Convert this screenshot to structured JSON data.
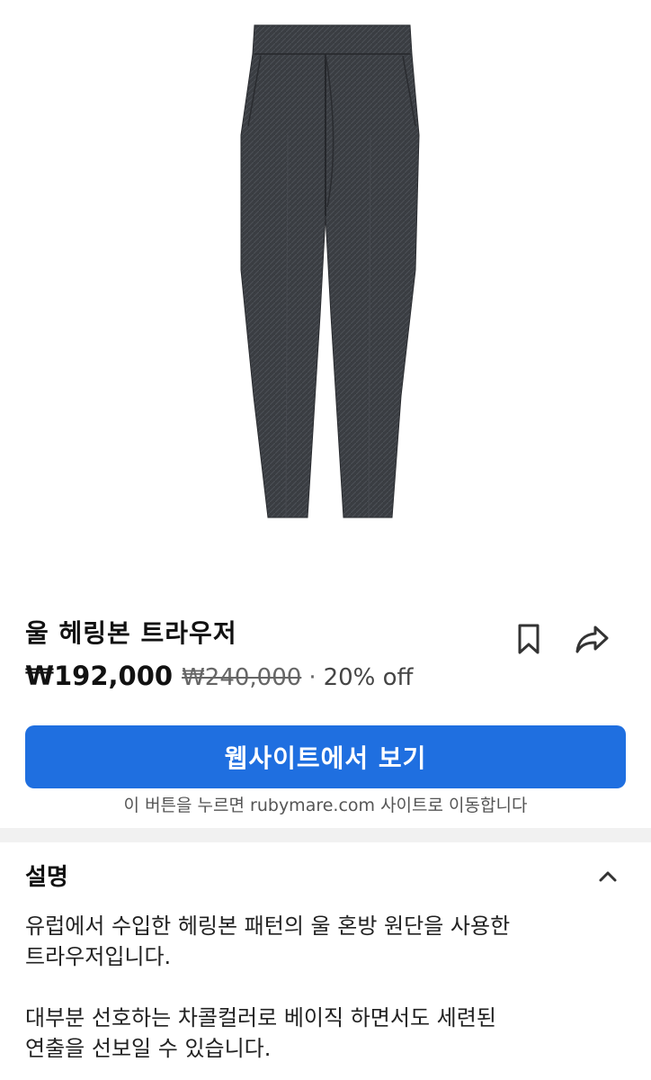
{
  "product": {
    "image_icon": "product-photo-trousers",
    "title": "울 헤링본 트라우저",
    "price_current": "₩192,000",
    "price_original": "₩240,000",
    "price_separator": "·",
    "discount": "20% off"
  },
  "actions": {
    "bookmark_icon": "bookmark-icon",
    "share_icon": "share-icon"
  },
  "cta": {
    "label": "웹사이트에서 보기",
    "note": "이 버튼을 누르면 rubymare.com 사이트로 이동합니다"
  },
  "description": {
    "heading": "설명",
    "collapse_icon": "chevron-up-icon",
    "paragraph1_line1": "유럽에서 수입한 헤링본 패턴의 울 혼방 원단을 사용한",
    "paragraph1_line2": "트라우저입니다.",
    "paragraph2_line1": "대부분 선호하는 차콜컬러로 베이직 하면서도 세련된",
    "paragraph2_line2": "연출을 선보일 수 있습니다."
  },
  "colors": {
    "accent": "#1f6fe0",
    "garment": "#3a3d42"
  }
}
